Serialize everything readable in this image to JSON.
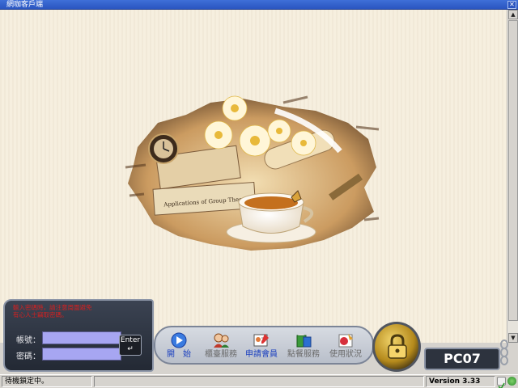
{
  "window": {
    "title": "網咖客戶端",
    "close_symbol": "✕"
  },
  "scrollbar": {
    "up_symbol": "▲",
    "down_symbol": "▼"
  },
  "painting": {
    "book_text": "Applications of Group Theory"
  },
  "login": {
    "warning_line1": "輸入密碼時，請注意周圍避免",
    "warning_line2": "有心人士竊取密碼。",
    "account_label": "帳號：",
    "password_label": "密碼：",
    "account_value": "",
    "password_value": "",
    "enter_label": "Enter",
    "enter_symbol": "↵"
  },
  "commands": [
    {
      "label": "開　始",
      "icon": "play-icon",
      "color": "#1a3fbf"
    },
    {
      "label": "櫃臺服務",
      "icon": "counter-service-icon",
      "color": "#6a6a6a"
    },
    {
      "label": "申請會員",
      "icon": "member-apply-icon",
      "color": "#1a3fbf"
    },
    {
      "label": "點餐服務",
      "icon": "order-food-icon",
      "color": "#6a6a6a"
    },
    {
      "label": "使用狀況",
      "icon": "usage-status-icon",
      "color": "#6a6a6a"
    }
  ],
  "station": {
    "name": "PC07"
  },
  "status": {
    "message": "待機鎖定中。",
    "version": "Version 3.33"
  },
  "colors": {
    "accent": "#2a55c0",
    "field_bg": "#a7a6f2",
    "warning": "#d42020"
  }
}
